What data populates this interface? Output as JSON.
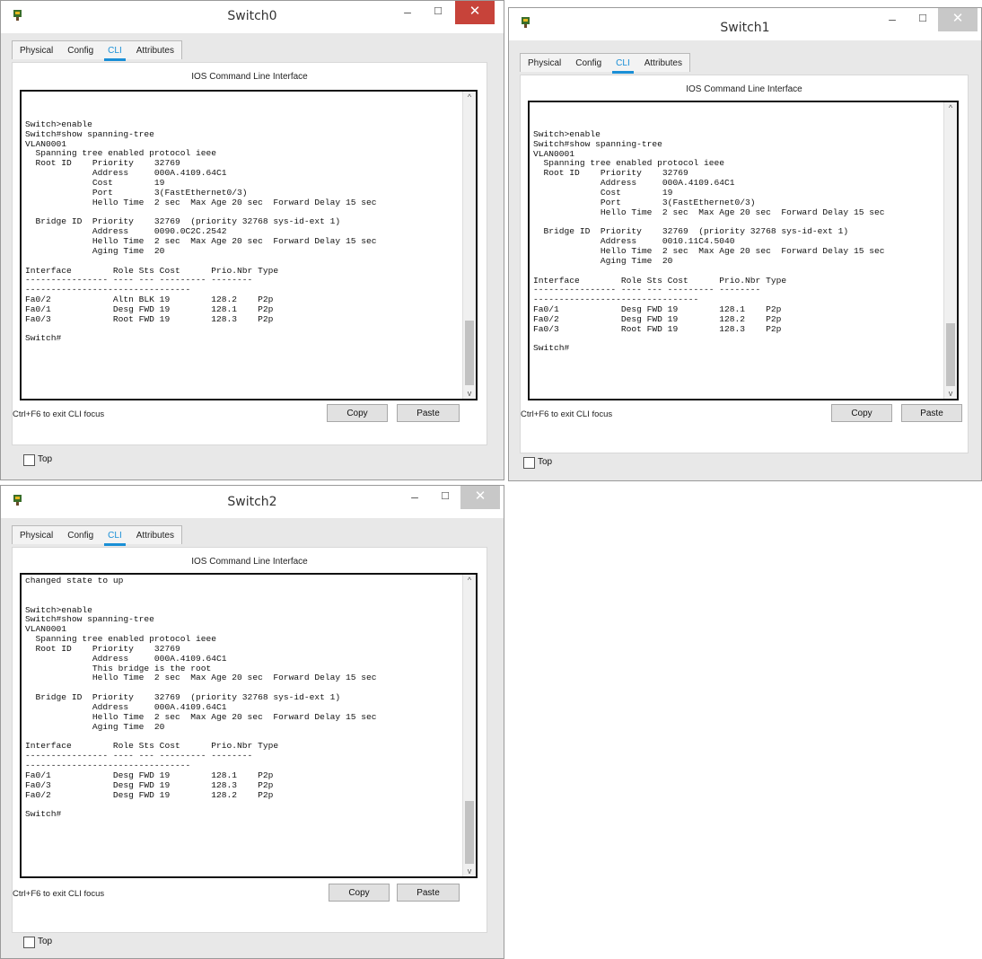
{
  "tabs": [
    "Physical",
    "Config",
    "CLI",
    "Attributes"
  ],
  "cli_heading": "IOS Command Line Interface",
  "exit_hint": "Ctrl+F6 to exit CLI focus",
  "copy_label": "Copy",
  "paste_label": "Paste",
  "top_label": "Top",
  "controls": {
    "minimize": "–",
    "maximize": "☐",
    "close": "✕",
    "scroll_up": "^",
    "scroll_down": "v"
  },
  "colors": {
    "close_active": "#c7433a",
    "close_inactive": "#c8c8c8",
    "tab_accent": "#1a8fd6"
  },
  "windows": [
    {
      "title": "Switch0",
      "active": true,
      "terminal_text": "\nSwitch>enable\nSwitch#show spanning-tree\nVLAN0001\n  Spanning tree enabled protocol ieee\n  Root ID    Priority    32769\n             Address     000A.4109.64C1\n             Cost        19\n             Port        3(FastEthernet0/3)\n             Hello Time  2 sec  Max Age 20 sec  Forward Delay 15 sec\n\n  Bridge ID  Priority    32769  (priority 32768 sys-id-ext 1)\n             Address     0090.0C2C.2542\n             Hello Time  2 sec  Max Age 20 sec  Forward Delay 15 sec\n             Aging Time  20\n\nInterface        Role Sts Cost      Prio.Nbr Type\n---------------- ---- --- --------- --------\n--------------------------------\nFa0/2            Altn BLK 19        128.2    P2p\nFa0/1            Desg FWD 19        128.1    P2p\nFa0/3            Root FWD 19        128.3    P2p\n\nSwitch#"
    },
    {
      "title": "Switch1",
      "active": false,
      "terminal_text": "\nSwitch>enable\nSwitch#show spanning-tree\nVLAN0001\n  Spanning tree enabled protocol ieee\n  Root ID    Priority    32769\n             Address     000A.4109.64C1\n             Cost        19\n             Port        3(FastEthernet0/3)\n             Hello Time  2 sec  Max Age 20 sec  Forward Delay 15 sec\n\n  Bridge ID  Priority    32769  (priority 32768 sys-id-ext 1)\n             Address     0010.11C4.5040\n             Hello Time  2 sec  Max Age 20 sec  Forward Delay 15 sec\n             Aging Time  20\n\nInterface        Role Sts Cost      Prio.Nbr Type\n---------------- ---- --- --------- --------\n--------------------------------\nFa0/1            Desg FWD 19        128.1    P2p\nFa0/2            Desg FWD 19        128.2    P2p\nFa0/3            Root FWD 19        128.3    P2p\n\nSwitch#"
    },
    {
      "title": "Switch2",
      "active": false,
      "terminal_text": "changed state to up\n\n\nSwitch>enable\nSwitch#show spanning-tree\nVLAN0001\n  Spanning tree enabled protocol ieee\n  Root ID    Priority    32769\n             Address     000A.4109.64C1\n             This bridge is the root\n             Hello Time  2 sec  Max Age 20 sec  Forward Delay 15 sec\n\n  Bridge ID  Priority    32769  (priority 32768 sys-id-ext 1)\n             Address     000A.4109.64C1\n             Hello Time  2 sec  Max Age 20 sec  Forward Delay 15 sec\n             Aging Time  20\n\nInterface        Role Sts Cost      Prio.Nbr Type\n---------------- ---- --- --------- --------\n--------------------------------\nFa0/1            Desg FWD 19        128.1    P2p\nFa0/3            Desg FWD 19        128.3    P2p\nFa0/2            Desg FWD 19        128.2    P2p\n\nSwitch#"
    }
  ]
}
